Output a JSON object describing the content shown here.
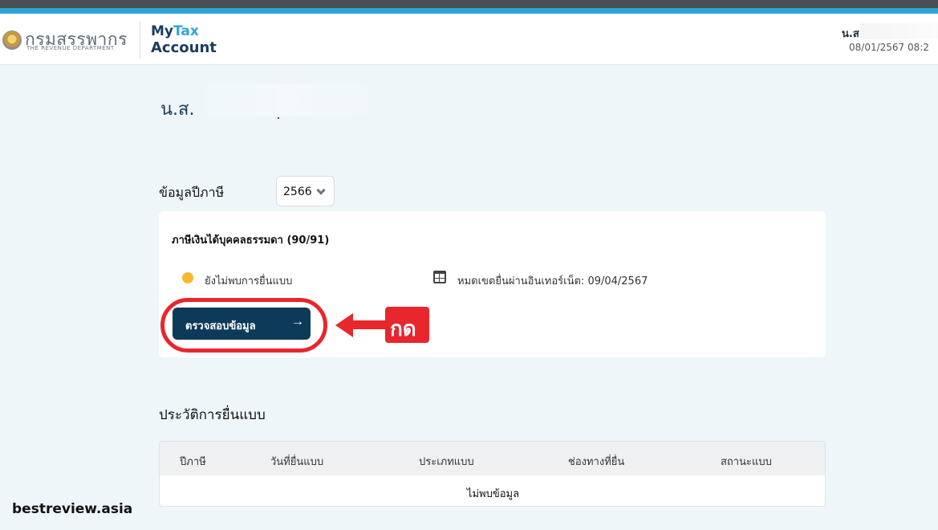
{
  "header": {
    "logo_thai": "กรมสรรพากร",
    "logo_english": "THE REVENUE DEPARTMENT",
    "app_name_my": "My",
    "app_name_tax": "Tax",
    "app_name_account": "Account",
    "user_name": "น.ส.",
    "datetime": "08/01/2567   08:2"
  },
  "main": {
    "user_name": "น.ส.",
    "tax_year_label": "ข้อมูลปีภาษี",
    "tax_year_selected": "2566",
    "card": {
      "title": "ภาษีเงินได้บุคคลธรรมดา (90/91)",
      "status_text": "ยังไม่พบการยื่นแบบ",
      "status_color": "#f5b82e",
      "deadline_text": "หมดเขตยื่นผ่านอินเทอร์เน็ต: 09/04/2567",
      "check_button_label": "ตรวจสอบข้อมูล",
      "check_button_arrow": "→"
    },
    "annotation": {
      "press_label": "กด",
      "color": "#e8262d"
    },
    "history": {
      "title": "ประวัติการยื่นแบบ",
      "columns": [
        "ปีภาษี",
        "วันที่ยื่นแบบ",
        "ประเภทแบบ",
        "ช่องทางที่ยื่น",
        "สถานะแบบ"
      ],
      "empty_text": "ไม่พบข้อมูล"
    }
  },
  "watermark": "bestreview.asia"
}
